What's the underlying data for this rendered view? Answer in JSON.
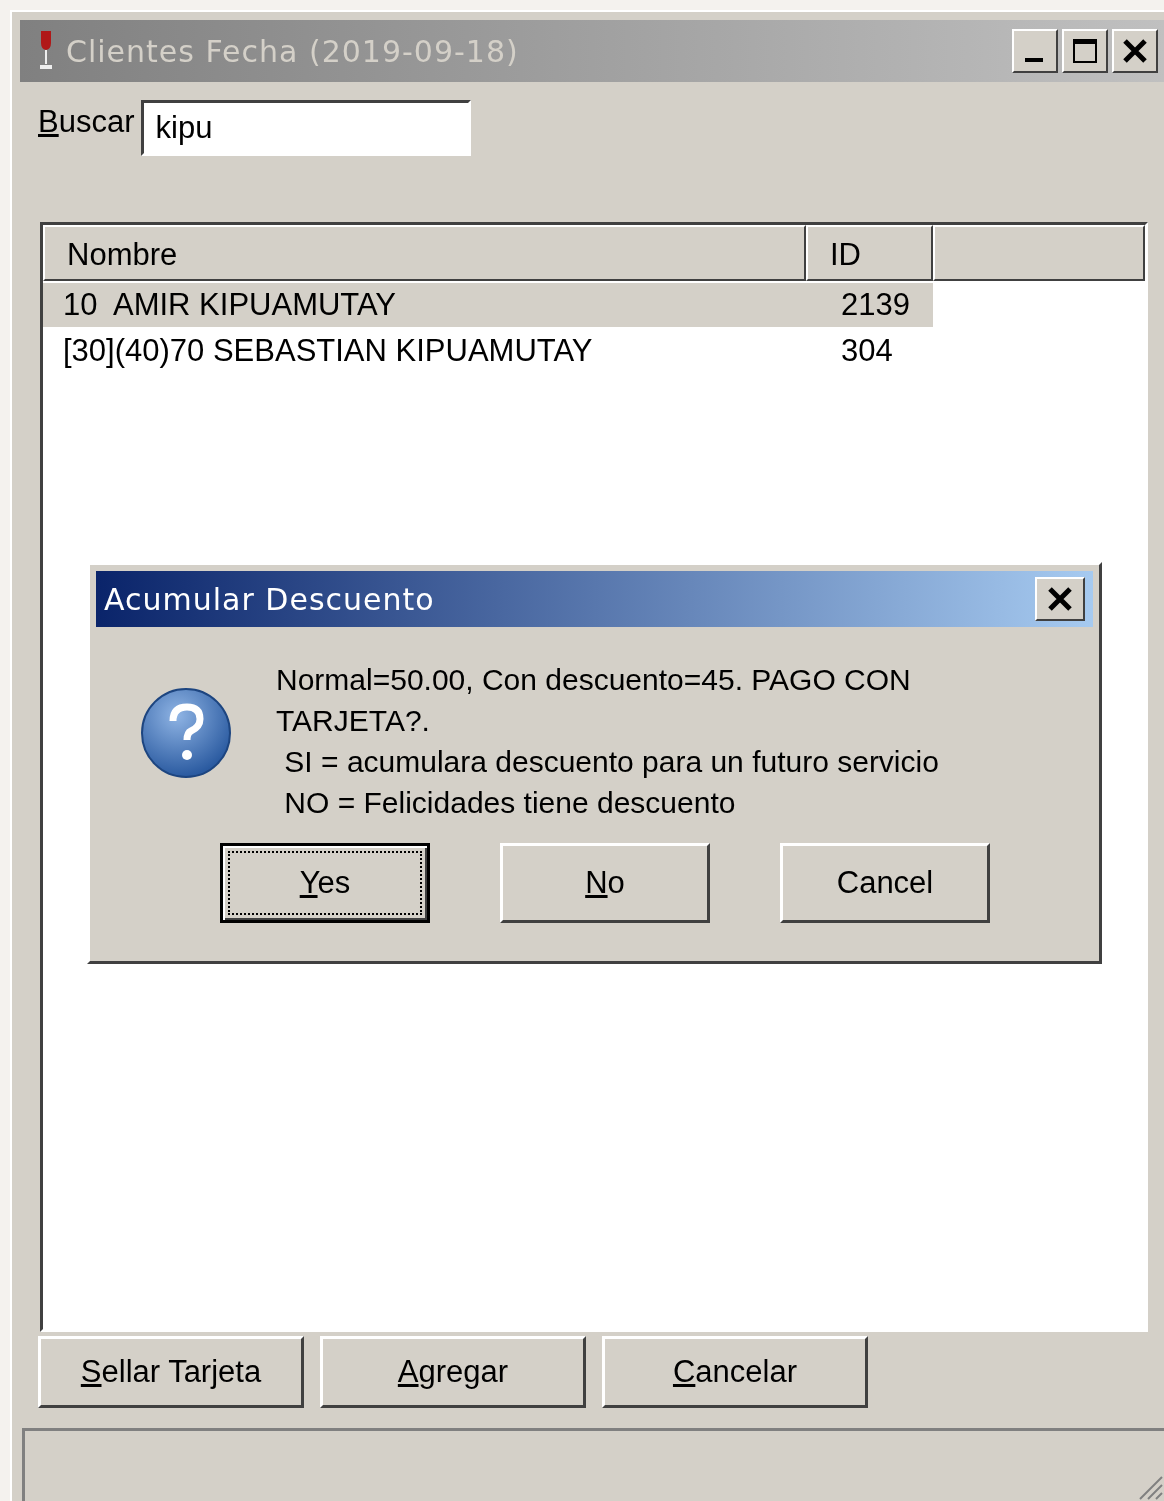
{
  "window": {
    "title": "Clientes Fecha (2019-09-18)"
  },
  "search": {
    "label": "Buscar",
    "mnemonic": true,
    "value": "kipu"
  },
  "table": {
    "columns": [
      "Nombre",
      "ID"
    ],
    "rows": [
      {
        "cells": [
          "10  AMIR KIPUAMUTAY",
          "2139"
        ],
        "selected": true
      },
      {
        "cells": [
          "[30](40)70 SEBASTIAN KIPUAMUTAY",
          "304"
        ],
        "selected": false
      }
    ]
  },
  "buttons": [
    {
      "label": "Sellar Tarjeta",
      "mnemonic": true
    },
    {
      "label": "Agregar",
      "mnemonic": true
    },
    {
      "label": "Cancelar",
      "mnemonic": true
    }
  ],
  "dialog": {
    "title": "Acumular Descuento",
    "message": "Normal=50.00, Con descuento=45. PAGO CON TARJETA?.\n SI = acumulara descuento para un futuro servicio\n NO = Felicidades tiene descuento",
    "buttons": [
      {
        "label": "Yes",
        "mnemonic": true,
        "focused": true
      },
      {
        "label": "No",
        "mnemonic": true,
        "focused": false
      },
      {
        "label": "Cancel",
        "mnemonic": false,
        "focused": false
      }
    ]
  }
}
